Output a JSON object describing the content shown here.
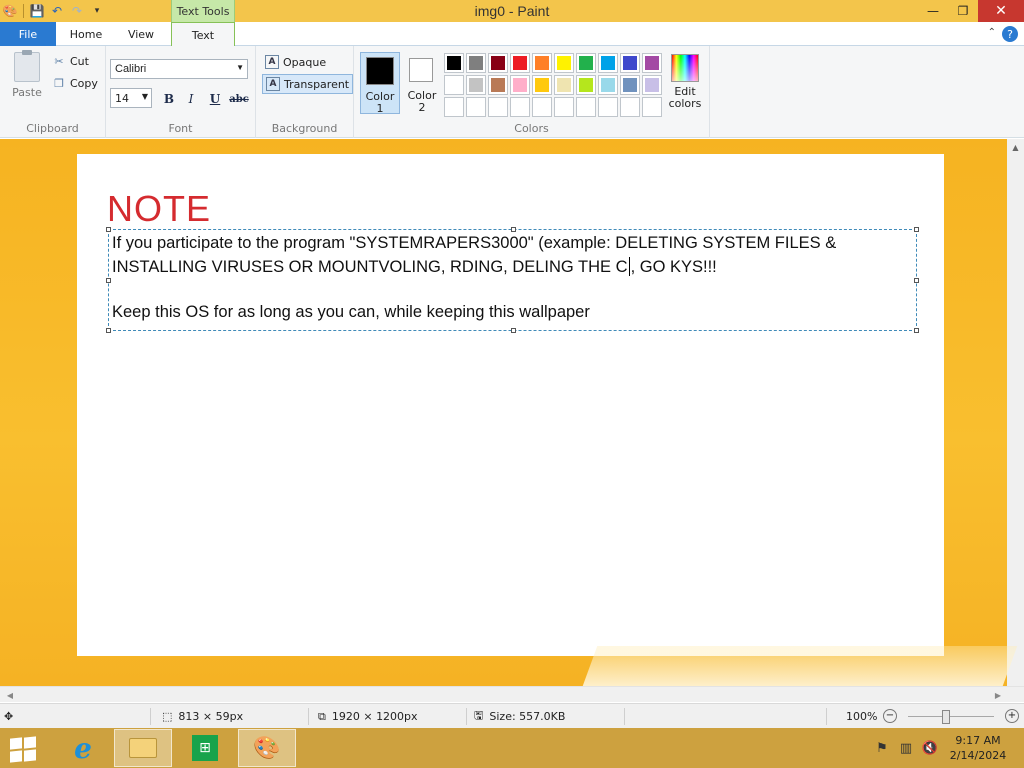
{
  "window": {
    "title": "img0 - Paint",
    "context_tab": "Text Tools",
    "minimize": "—",
    "restore": "❐",
    "close": "✕"
  },
  "tabs": {
    "file": "File",
    "home": "Home",
    "view": "View",
    "text": "Text"
  },
  "ribbon": {
    "clipboard": {
      "label": "Clipboard",
      "paste": "Paste",
      "cut": "Cut",
      "copy": "Copy"
    },
    "font": {
      "label": "Font",
      "family": "Calibri",
      "size": "14",
      "bold": "B",
      "italic": "I",
      "underline": "U",
      "strike": "abc"
    },
    "background": {
      "label": "Background",
      "opaque": "Opaque",
      "transparent": "Transparent",
      "selected": "Transparent"
    },
    "colors": {
      "label": "Colors",
      "color1_label": "Color 1",
      "color2_label": "Color 2",
      "color1": "#000000",
      "color2": "#ffffff",
      "edit_colors": "Edit colors",
      "palette": [
        "#000000",
        "#7f7f7f",
        "#880015",
        "#ed1c24",
        "#ff7f27",
        "#fff200",
        "#22b14c",
        "#00a2e8",
        "#3f48cc",
        "#a349a4",
        "#ffffff",
        "#c3c3c3",
        "#b97a57",
        "#ffaec9",
        "#ffc90e",
        "#efe4b0",
        "#b5e61d",
        "#99d9ea",
        "#7092be",
        "#c8bfe7",
        "",
        "",
        "",
        "",
        "",
        "",
        "",
        "",
        "",
        ""
      ]
    }
  },
  "canvas": {
    "heading": "NOTE",
    "heading_color": "#d52b2f",
    "line1": "If you participate to the program \"SYSTEMRAPERS3000\" (example: DELETING SYSTEM FILES &",
    "line2_before_caret": "INSTALLING VIRUSES OR MOUNTVOLING, RDING, DELING THE C",
    "line2_after_caret": ", GO KYS!!!",
    "line3": "Keep this OS for as long as you can, while keeping this wallpaper"
  },
  "status": {
    "selection_size": "813 × 59px",
    "image_size": "1920 × 1200px",
    "file_size": "Size: 557.0KB",
    "zoom": "100%",
    "zoom_level": 1.0
  },
  "taskbar": {
    "time": "9:17 AM",
    "date": "2/14/2024"
  }
}
